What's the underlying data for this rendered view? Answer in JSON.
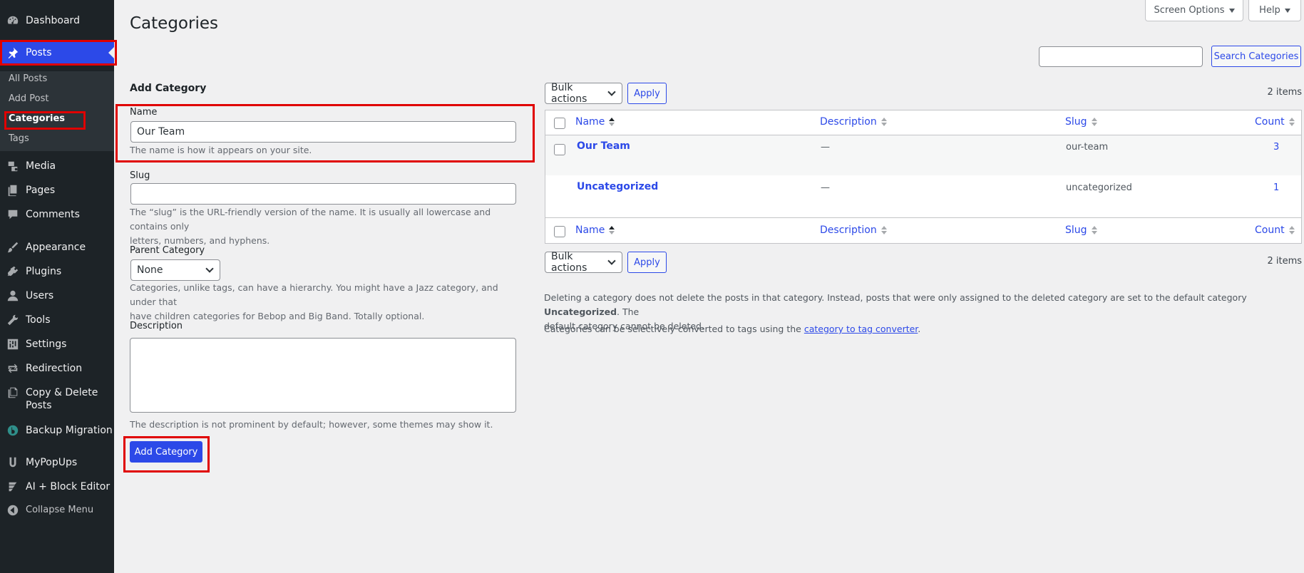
{
  "sidebar": {
    "items": [
      {
        "label": "Dashboard",
        "icon": "dashboard-icon"
      },
      {
        "label": "Posts",
        "icon": "pin-icon"
      },
      {
        "label": "Media",
        "icon": "media-icon"
      },
      {
        "label": "Pages",
        "icon": "pages-icon"
      },
      {
        "label": "Comments",
        "icon": "comment-icon"
      },
      {
        "label": "Appearance",
        "icon": "brush-icon"
      },
      {
        "label": "Plugins",
        "icon": "plug-icon"
      },
      {
        "label": "Users",
        "icon": "user-icon"
      },
      {
        "label": "Tools",
        "icon": "wrench-icon"
      },
      {
        "label": "Settings",
        "icon": "settings-icon"
      },
      {
        "label": "Redirection",
        "icon": "redirect-icon"
      },
      {
        "label": "Copy & Delete",
        "label2": "Posts",
        "icon": "copy-icon"
      },
      {
        "label": "Backup Migration",
        "icon": "backup-icon"
      },
      {
        "label": "MyPopUps",
        "icon": "popup-icon"
      },
      {
        "label": "AI + Block Editor",
        "icon": "ai-icon"
      }
    ],
    "submenu": [
      "All Posts",
      "Add Post",
      "Categories",
      "Tags"
    ],
    "collapse": "Collapse Menu"
  },
  "top": {
    "screen_options": "Screen Options",
    "help": "Help"
  },
  "page_title": "Categories",
  "form": {
    "heading": "Add Category",
    "name_label": "Name",
    "name_value": "Our Team",
    "name_help": "The name is how it appears on your site.",
    "slug_label": "Slug",
    "slug_help_1": "The “slug” is the URL-friendly version of the name. It is usually all lowercase and contains only",
    "slug_help_2": "letters, numbers, and hyphens.",
    "parent_label": "Parent Category",
    "parent_value": "None",
    "parent_help_1": "Categories, unlike tags, can have a hierarchy. You might have a Jazz category, and under that",
    "parent_help_2": "have children categories for Bebop and Big Band. Totally optional.",
    "desc_label": "Description",
    "desc_help": "The description is not prominent by default; however, some themes may show it.",
    "submit": "Add Category"
  },
  "list": {
    "search_button": "Search Categories",
    "bulk_label": "Bulk actions",
    "apply": "Apply",
    "items_count": "2 items",
    "columns": {
      "name": "Name",
      "description": "Description",
      "slug": "Slug",
      "count": "Count"
    },
    "rows": [
      {
        "name": "Our Team",
        "description": "—",
        "slug": "our-team",
        "count": "3"
      },
      {
        "name": "Uncategorized",
        "description": "—",
        "slug": "uncategorized",
        "count": "1"
      }
    ],
    "note_1a": "Deleting a category does not delete the posts in that category. Instead, posts that were only assigned to the deleted category are set to the default category ",
    "note_1b": "Uncategorized",
    "note_1c": ". The",
    "note_2": "default category cannot be deleted.",
    "note_3a": "Categories can be selectively converted to tags using the ",
    "note_3b": "category to tag converter",
    "note_3c": "."
  },
  "colors": {
    "accent": "#2c49e8",
    "sidebar": "#1d2327",
    "highlight": "#e00000"
  }
}
